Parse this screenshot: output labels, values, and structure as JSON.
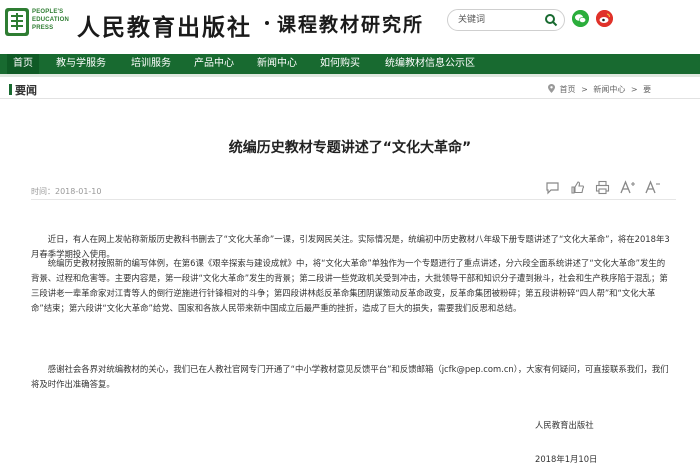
{
  "header": {
    "logo_text": [
      "PEOPLE'S",
      "EDUCATION",
      "PRESS"
    ],
    "brand": "人民教育出版社",
    "sub_brand": "课程教材研究所",
    "search": {
      "placeholder": "关键词"
    }
  },
  "nav": {
    "items": [
      "首页",
      "教与学服务",
      "培训服务",
      "产品中心",
      "新闻中心",
      "如何购买",
      "统编教材信息公示区"
    ],
    "active_index": 0
  },
  "breadcrumb": {
    "section_title": "要闻",
    "path": [
      "首页",
      ">",
      "新闻中心",
      ">",
      "要"
    ]
  },
  "article": {
    "title": "统编历史教材专题讲述了“文化大革命”",
    "date_label": "时间：2018-01-10",
    "paragraphs": [
      "近日，有人在网上发帖称新版历史教科书删去了“文化大革命”一课，引发网民关注。实际情况是，统编初中历史教材八年级下册专题讲述了“文化大革命”，将在2018年3月春季学期投入使用。",
      "统编历史教材按照新的编写体例，在第6课《艰辛探索与建设成就》中，将“文化大革命”单独作为一个专题进行了重点讲述，分六段全面系统讲述了“文化大革命”发生的背景、过程和危害等。主要内容是，第一段讲“文化大革命”发生的背景；第二段讲一些党政机关受到冲击，大批领导干部和知识分子遭到揪斗，社会和生产秩序陷于混乱；第三段讲老一辈革命家对江青等人的倒行逆施进行针锋相对的斗争；第四段讲林彪反革命集团阴谋策动反革命政变，反革命集团被粉碎；第五段讲粉碎“四人帮”和“文化大革命”结束；第六段讲“文化大革命”给党、国家和各族人民带来新中国成立后最严重的挫折，造成了巨大的损失，需要我们反思和总结。",
      "感谢社会各界对统编教材的关心，我们已在人教社官网专门开通了“中小学教材意见反馈平台”和反馈邮箱（jcfk@pep.com.cn），大家有何疑问，可直接联系我们，我们将及时作出准确答复。"
    ],
    "signature": "人民教育出版社",
    "sign_date": "2018年1月10日"
  },
  "colors": {
    "nav_bg": "#186a30",
    "accent": "#186a30",
    "search_icon": "#186a30",
    "wechat": "#2bae3c",
    "weibo": "#e0322a"
  },
  "icons": [
    "logo-mark-icon",
    "search-icon",
    "wechat-icon",
    "weibo-icon",
    "location-icon",
    "comment-icon",
    "thumbs-up-icon",
    "print-icon",
    "font-increase-icon",
    "font-decrease-icon"
  ]
}
